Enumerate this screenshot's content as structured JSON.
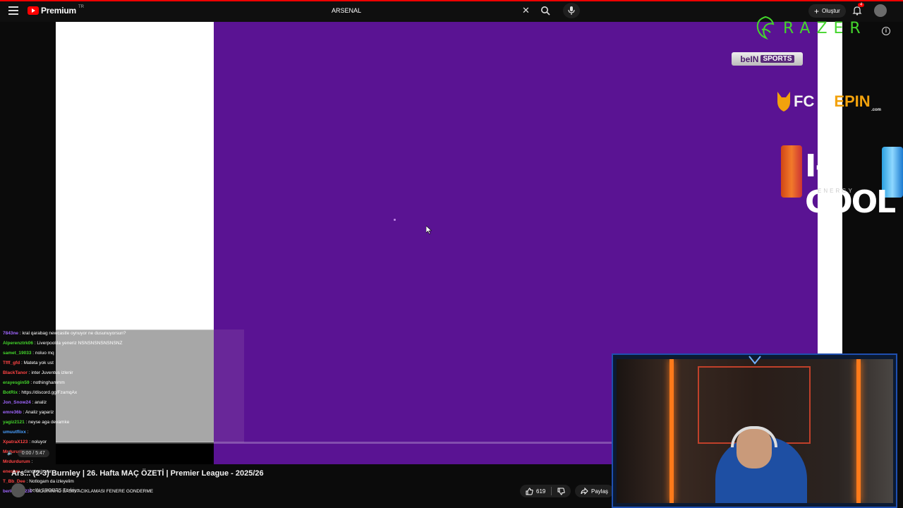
{
  "header": {
    "logo_text": "Premium",
    "logo_sup": "TR",
    "search_value": "ARSENAL",
    "create_label": "Oluştur",
    "notif_count": "4"
  },
  "overlays": {
    "razer": "RAZER",
    "bein_left": "beIN",
    "bein_right": "SPORTS",
    "fc": "FC",
    "epin": "EPIN",
    "epin_com": ".com",
    "icool": "I-COOL",
    "icool_sub": "ENERGY"
  },
  "chat": [
    {
      "user": "7843ne",
      "msg": ": kral qarabag newcastle oynuyor ne dusunuyorsun?",
      "color": "#a066ff"
    },
    {
      "user": "Alperenztrk06",
      "msg": ": Liverpoolda yeneriz NSNSNSNSNSNSNZ",
      "color": "#44d62c"
    },
    {
      "user": "samet_19033",
      "msg": ": noluo mq",
      "color": "#44d62c"
    },
    {
      "user": "Tfff_gfd",
      "msg": ": Mateta yok ust",
      "color": "#ff4444"
    },
    {
      "user": "BlackTanor",
      "msg": ": inter Juventus izlenir",
      "color": "#ff4444"
    },
    {
      "user": "erayesgin59",
      "msg": ": nothinghammm",
      "color": "#44d62c"
    },
    {
      "user": "BotRix",
      "msg": ": https://discord.gg/FzamqAx",
      "color": "#44d62c"
    },
    {
      "user": "Jon_Snow24",
      "msg": ": analiz",
      "color": "#a066ff"
    },
    {
      "user": "emre36b",
      "msg": ": Analiz yapariz",
      "color": "#a066ff"
    },
    {
      "user": "yagiz2121",
      "msg": ": neyse aga devamke",
      "color": "#44d62c"
    },
    {
      "user": "umuutflixx",
      "msg": ":",
      "color": "#4aa0ff"
    },
    {
      "user": "XpatraX123",
      "msg": ": noluyor",
      "color": "#ff4444"
    },
    {
      "user": "Mrdurum",
      "msg": ":",
      "color": "#ff4444"
    },
    {
      "user": "Mrdurdurum",
      "msg": ":",
      "color": "#ff4444"
    },
    {
      "user": "enesbm",
      "msg": ": dangemiz var",
      "color": "#ff4444"
    },
    {
      "user": "T_Bb_Dee",
      "msg": ": Notlogam da izleyelim",
      "color": "#ff4444"
    },
    {
      "user": "berkobalk231",
      "msg": ": MOURINHO BASIN ACIKLAMASI FENERE GONDERME",
      "color": "#a066ff"
    }
  ],
  "player": {
    "time": "0:00 / 5:47",
    "progress_fraction": 0.0
  },
  "video": {
    "title": "Ars... (2-3) Burnley | 26. Hafta MAÇ ÖZETİ | Premier League - 2025/26",
    "channel": "beIN SPORTS Türkiye"
  },
  "actions": {
    "like_count": "619",
    "share_label": "Paylaş"
  },
  "icons": [
    "menu-icon",
    "youtube-logo",
    "close-icon",
    "search-icon",
    "mic-icon",
    "plus-icon",
    "bell-icon",
    "info-icon",
    "cursor-icon",
    "like-icon",
    "dislike-icon",
    "share-icon"
  ]
}
